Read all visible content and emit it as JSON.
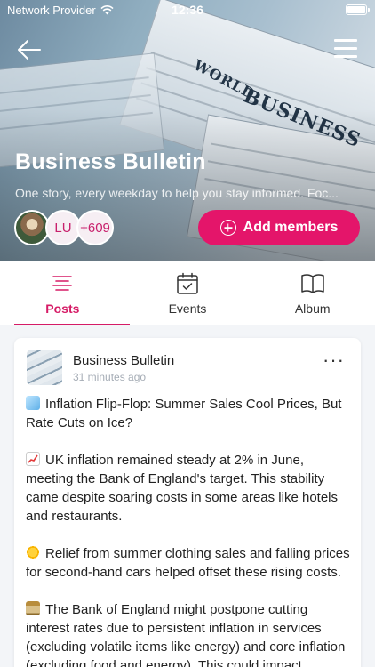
{
  "status_bar": {
    "carrier": "Network Provider",
    "time": "12:36"
  },
  "hero": {
    "image_words": [
      "WORLD",
      "BUSINESS"
    ],
    "title": "Business Bulletin",
    "description": "One story, every weekday to help you stay informed. Foc...",
    "members": {
      "initials": "LU",
      "more_count": "+609"
    },
    "add_members_label": "Add members"
  },
  "tabs": [
    {
      "label": "Posts",
      "icon": "list-lines-icon",
      "active": true
    },
    {
      "label": "Events",
      "icon": "calendar-check-icon",
      "active": false
    },
    {
      "label": "Album",
      "icon": "open-book-icon",
      "active": false
    }
  ],
  "post": {
    "author": "Business Bulletin",
    "time": "31 minutes ago",
    "paragraphs": [
      {
        "emoji": "ice-cube",
        "text": "Inflation Flip-Flop: Summer Sales Cool Prices, But Rate Cuts on Ice?"
      },
      {
        "emoji": "chart-increasing",
        "text": "UK inflation remained steady at 2% in June, meeting the Bank of England's target. This stability came despite soaring costs in some areas like hotels and restaurants."
      },
      {
        "emoji": "sun",
        "text": "Relief from summer clothing sales and falling prices for second-hand cars helped offset these rising costs."
      },
      {
        "emoji": "bank",
        "text": "The Bank of England might postpone cutting interest rates due to persistent inflation in services (excluding volatile items like energy) and core inflation (excluding food and energy). This could impact"
      }
    ]
  },
  "colors": {
    "accent": "#e4156a",
    "tab_active": "#d61b66"
  }
}
